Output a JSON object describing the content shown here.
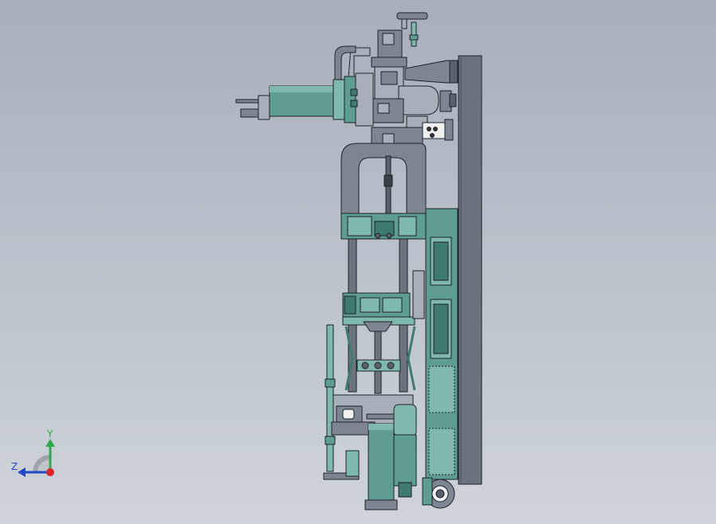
{
  "viewport": {
    "background_top": "#a6afba",
    "background_bottom": "#cfd4da"
  },
  "model": {
    "colors": {
      "teal": "#5f9c92",
      "teal_light": "#7fb8ad",
      "teal_dark": "#3f7a70",
      "grey": "#7d8591",
      "grey_dark": "#5a616c",
      "grey_light": "#a8afb8",
      "outline": "#1e2328",
      "plate": "#6c737d"
    }
  },
  "triad": {
    "y_label": "Y",
    "z_label": "Z",
    "y_color": "#2ea84a",
    "z_color": "#2248c8",
    "origin_color": "#d8232a"
  }
}
